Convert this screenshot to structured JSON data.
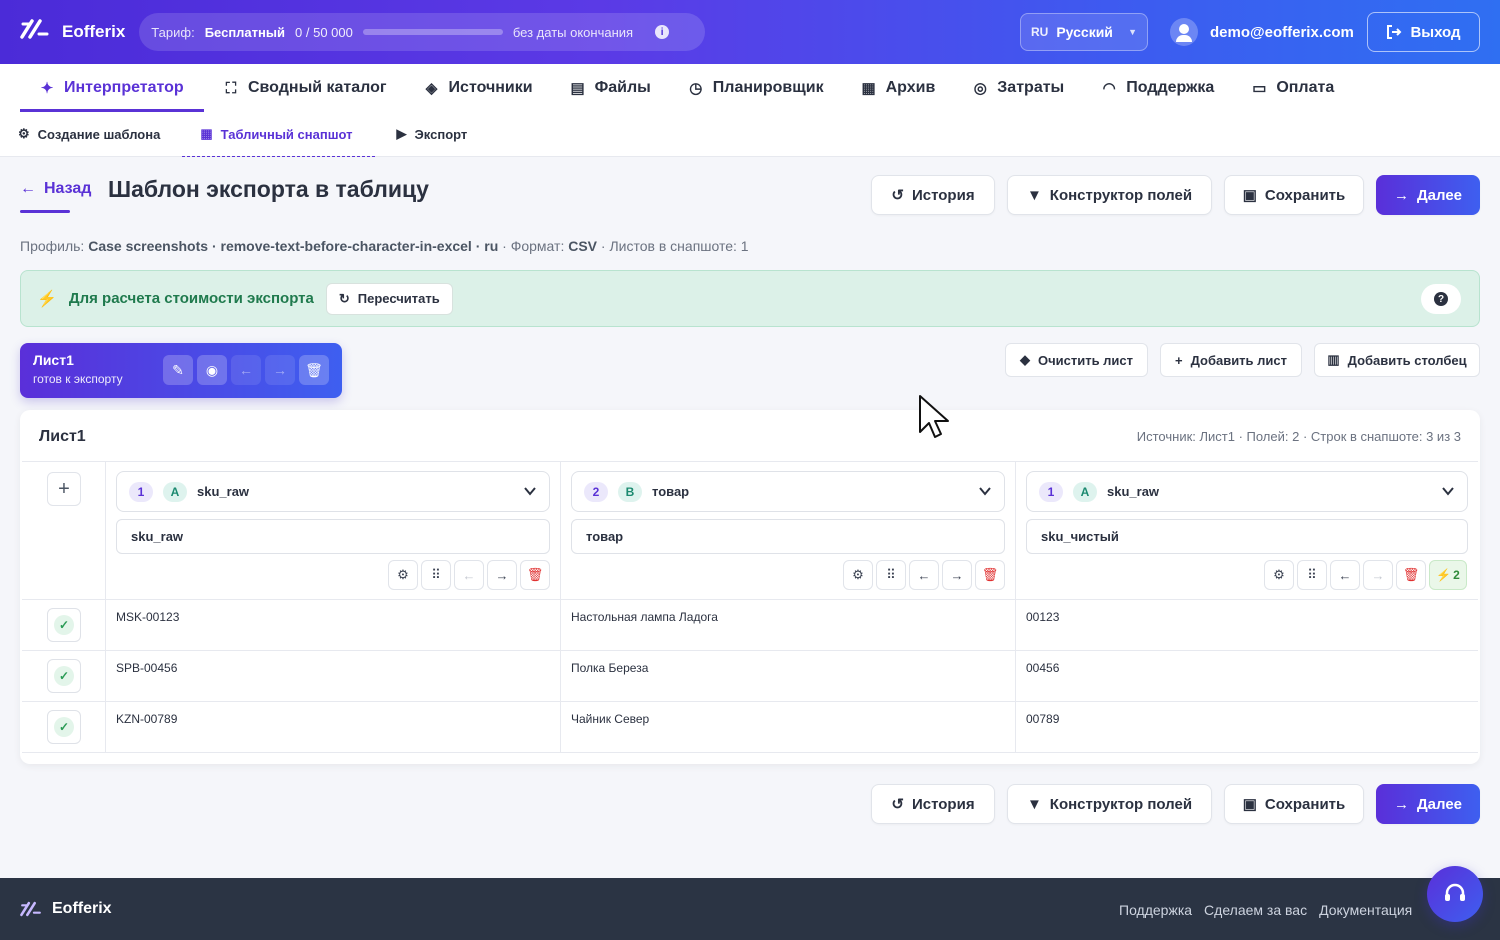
{
  "app": {
    "name": "Eofferix",
    "tariff_label": "Тариф:",
    "tariff_plan": "Бесплатный",
    "tariff_used": "0",
    "tariff_sep": "/",
    "tariff_limit": "50 000",
    "tariff_usage_fraction": 0,
    "tariff_expiry": "без даты окончания",
    "lang_code": "RU",
    "lang_name": "Русский",
    "user_email": "demo@eofferix.com",
    "logout_label": "Выход"
  },
  "main_nav": [
    {
      "label": "Интерпретатор",
      "icon": "magic-wand-icon",
      "active": true
    },
    {
      "label": "Сводный каталог",
      "icon": "sitemap-icon"
    },
    {
      "label": "Источники",
      "icon": "layers-icon"
    },
    {
      "label": "Файлы",
      "icon": "files-icon"
    },
    {
      "label": "Планировщик",
      "icon": "clock-icon"
    },
    {
      "label": "Архив",
      "icon": "archive-icon"
    },
    {
      "label": "Затраты",
      "icon": "coins-icon"
    },
    {
      "label": "Поддержка",
      "icon": "headset-icon"
    },
    {
      "label": "Оплата",
      "icon": "credit-card-icon"
    }
  ],
  "sub_nav": [
    {
      "label": "Создание шаблона",
      "icon": "gear-icon"
    },
    {
      "label": "Табличный снапшот",
      "icon": "table-icon",
      "active": true
    },
    {
      "label": "Экспорт",
      "icon": "play-circle-icon"
    }
  ],
  "page": {
    "back_label": "Назад",
    "title": "Шаблон экспорта в таблицу",
    "history_label": "История",
    "field_builder_label": "Конструктор полей",
    "save_label": "Сохранить",
    "next_label": "Далее",
    "profile_prefix": "Профиль:",
    "profile_value": "Case screenshots · remove-text-before-character-in-excel · ru",
    "format_prefix": "· Формат:",
    "format_value": "CSV",
    "sheets_info": "· Листов в снапшоте: 1"
  },
  "banner": {
    "text": "Для расчета стоимости экспорта",
    "recalc_label": "Пересчитать",
    "help": "?"
  },
  "sheet_card": {
    "name": "Лист1",
    "status": "готов к экспорту"
  },
  "sheet_actions": {
    "clear_label": "Очистить лист",
    "add_sheet_label": "Добавить лист",
    "add_column_label": "Добавить столбец"
  },
  "table": {
    "title": "Лист1",
    "meta": "Источник: Лист1 · Полей: 2 · Строк в снапшоте: 3 из 3",
    "columns": [
      {
        "index": "1",
        "letter": "A",
        "source": "sku_raw",
        "name": "sku_raw"
      },
      {
        "index": "2",
        "letter": "B",
        "source": "товар",
        "name": "товар"
      },
      {
        "index": "1",
        "letter": "A",
        "source": "sku_raw",
        "name": "sku_чистый",
        "rules_count": "2"
      }
    ],
    "rows": [
      [
        "MSK-00123",
        "Настольная лампа Ладога",
        "00123"
      ],
      [
        "SPB-00456",
        "Полка Береза",
        "00456"
      ],
      [
        "KZN-00789",
        "Чайник Север",
        "00789"
      ]
    ]
  },
  "footer": {
    "name": "Eofferix",
    "links": [
      "Поддержка",
      "Сделаем за вас",
      "Документация"
    ]
  },
  "colors": {
    "accent": "#5a32d6",
    "gradient_start": "#4b2bd8",
    "gradient_end": "#2f6ff2",
    "success": "#1f7a4d",
    "danger": "#e03131"
  }
}
